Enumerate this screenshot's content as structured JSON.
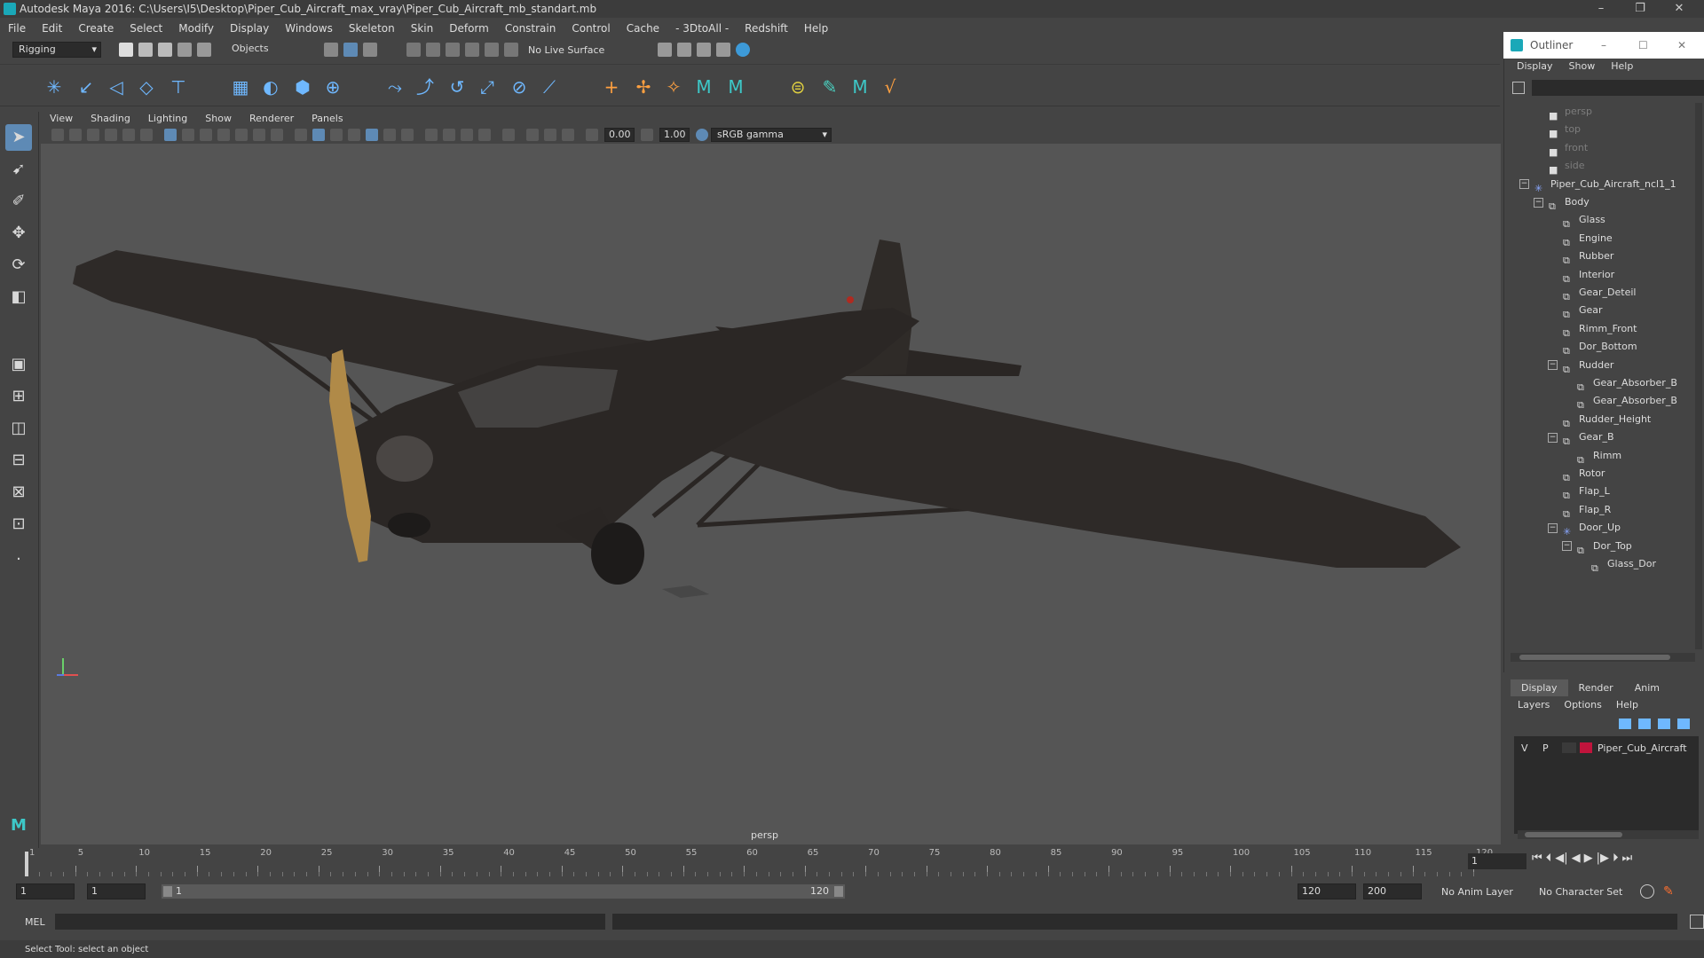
{
  "window": {
    "title": "Autodesk Maya 2016: C:\\Users\\I5\\Desktop\\Piper_Cub_Aircraft_max_vray\\Piper_Cub_Aircraft_mb_standart.mb",
    "min": "–",
    "max": "❐",
    "close": "✕"
  },
  "menu": [
    "File",
    "Edit",
    "Create",
    "Select",
    "Modify",
    "Display",
    "Windows",
    "Skeleton",
    "Skin",
    "Deform",
    "Constrain",
    "Control",
    "Cache",
    "- 3DtoAll -",
    "Redshift",
    "Help"
  ],
  "status": {
    "mode": "Rigging",
    "select_mask": "Objects",
    "live_surface": "No Live Surface"
  },
  "panel_menu": [
    "View",
    "Shading",
    "Lighting",
    "Show",
    "Renderer",
    "Panels"
  ],
  "panel_tools": {
    "exposure": "0.00",
    "gamma": "1.00",
    "color_space": "sRGB gamma"
  },
  "viewport": {
    "camera": "persp"
  },
  "outliner": {
    "title": "Outliner",
    "menu": [
      "Display",
      "Show",
      "Help"
    ],
    "items": [
      {
        "label": "persp",
        "depth": 1,
        "dim": true,
        "icon": "camera-icon"
      },
      {
        "label": "top",
        "depth": 1,
        "dim": true,
        "icon": "camera-icon"
      },
      {
        "label": "front",
        "depth": 1,
        "dim": true,
        "icon": "camera-icon"
      },
      {
        "label": "side",
        "depth": 1,
        "dim": true,
        "icon": "camera-icon"
      },
      {
        "label": "Piper_Cub_Aircraft_ncl1_1",
        "depth": 0,
        "exp": "−",
        "icon": "joint-icon"
      },
      {
        "label": "Body",
        "depth": 1,
        "exp": "−",
        "icon": "mesh-icon"
      },
      {
        "label": "Glass",
        "depth": 2,
        "icon": "mesh-icon"
      },
      {
        "label": "Engine",
        "depth": 2,
        "icon": "mesh-icon"
      },
      {
        "label": "Rubber",
        "depth": 2,
        "icon": "mesh-icon"
      },
      {
        "label": "Interior",
        "depth": 2,
        "icon": "mesh-icon"
      },
      {
        "label": "Gear_Deteil",
        "depth": 2,
        "icon": "mesh-icon"
      },
      {
        "label": "Gear",
        "depth": 2,
        "icon": "mesh-icon"
      },
      {
        "label": "Rimm_Front",
        "depth": 2,
        "icon": "mesh-icon"
      },
      {
        "label": "Dor_Bottom",
        "depth": 2,
        "icon": "mesh-icon"
      },
      {
        "label": "Rudder",
        "depth": 2,
        "exp": "−",
        "icon": "mesh-icon"
      },
      {
        "label": "Gear_Absorber_B",
        "depth": 3,
        "icon": "mesh-icon"
      },
      {
        "label": "Gear_Absorber_B",
        "depth": 3,
        "icon": "mesh-icon"
      },
      {
        "label": "Rudder_Height",
        "depth": 2,
        "icon": "mesh-icon"
      },
      {
        "label": "Gear_B",
        "depth": 2,
        "exp": "−",
        "icon": "mesh-icon"
      },
      {
        "label": "Rimm",
        "depth": 3,
        "icon": "mesh-icon"
      },
      {
        "label": "Rotor",
        "depth": 2,
        "icon": "mesh-icon"
      },
      {
        "label": "Flap_L",
        "depth": 2,
        "icon": "mesh-icon"
      },
      {
        "label": "Flap_R",
        "depth": 2,
        "icon": "mesh-icon"
      },
      {
        "label": "Door_Up",
        "depth": 2,
        "exp": "−",
        "icon": "joint-icon"
      },
      {
        "label": "Dor_Top",
        "depth": 3,
        "exp": "−",
        "icon": "mesh-icon"
      },
      {
        "label": "Glass_Dor",
        "depth": 4,
        "icon": "mesh-icon"
      }
    ]
  },
  "layers": {
    "tabs": [
      "Display",
      "Render",
      "Anim"
    ],
    "menu": [
      "Layers",
      "Options",
      "Help"
    ],
    "v": "V",
    "p": "P",
    "layer_name": "Piper_Cub_Aircraft",
    "layer_color": "#c0143c"
  },
  "timeline": {
    "ticks": [
      1,
      5,
      10,
      15,
      20,
      25,
      30,
      35,
      40,
      45,
      50,
      55,
      60,
      65,
      70,
      75,
      80,
      85,
      90,
      95,
      100,
      105,
      110,
      115,
      120
    ],
    "current": "1"
  },
  "range": {
    "start": "1",
    "playback_start": "1",
    "slider_start": "1",
    "slider_end": "120",
    "playback_end": "120",
    "end": "200",
    "anim_layer": "No Anim Layer",
    "char_set": "No Character Set"
  },
  "mel": {
    "label": "MEL"
  },
  "help_line": "Select Tool: select an object"
}
